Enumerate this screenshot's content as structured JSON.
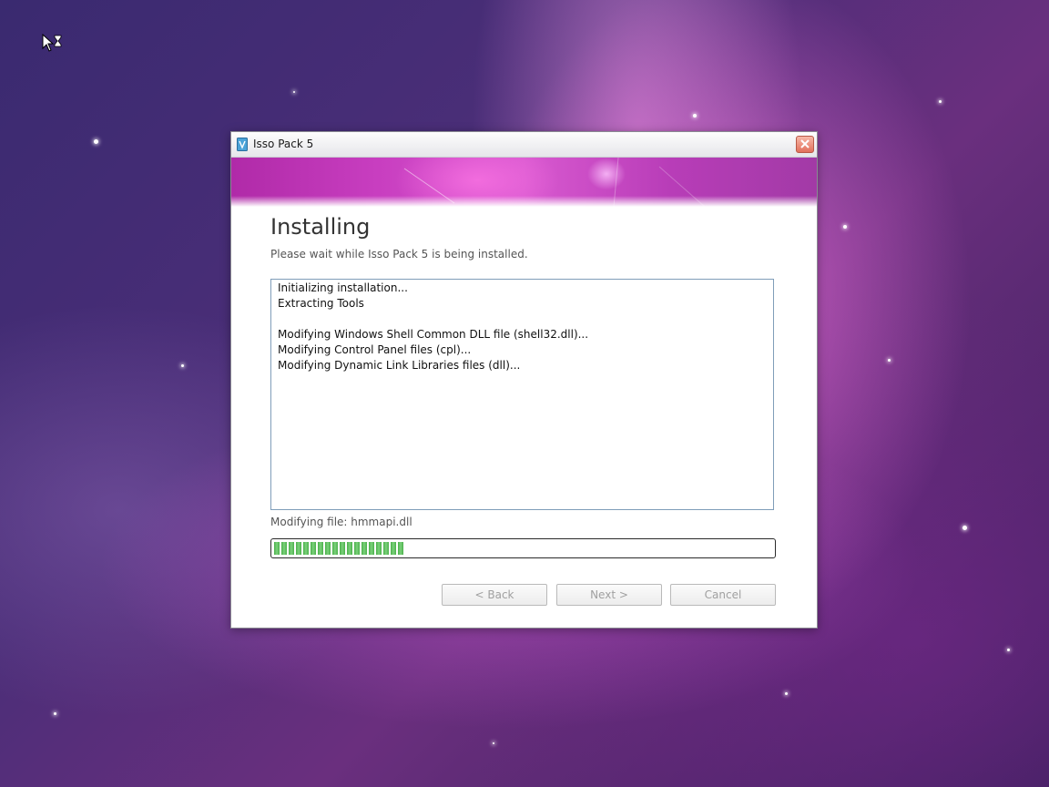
{
  "window": {
    "title": "Isso Pack 5",
    "heading": "Installing",
    "subheading": "Please wait while Isso Pack 5 is being installed.",
    "log_lines": [
      "Initializing installation...",
      "Extracting Tools",
      "",
      "Modifying Windows Shell Common DLL file (shell32.dll)...",
      "Modifying Control Panel files (cpl)...",
      "Modifying Dynamic Link Libraries files (dll)..."
    ],
    "status": "Modifying file: hmmapi.dll",
    "progress_fraction": 0.26,
    "buttons": {
      "back": "< Back",
      "next": "Next >",
      "cancel": "Cancel"
    }
  },
  "icons": {
    "cursor": "busy-arrow-cursor-icon",
    "app": "isso-pack-app-icon",
    "close": "close-icon"
  },
  "colors": {
    "banner": "#c83ec0",
    "progress": "#4bb04b",
    "log_border": "#7f9db9"
  }
}
